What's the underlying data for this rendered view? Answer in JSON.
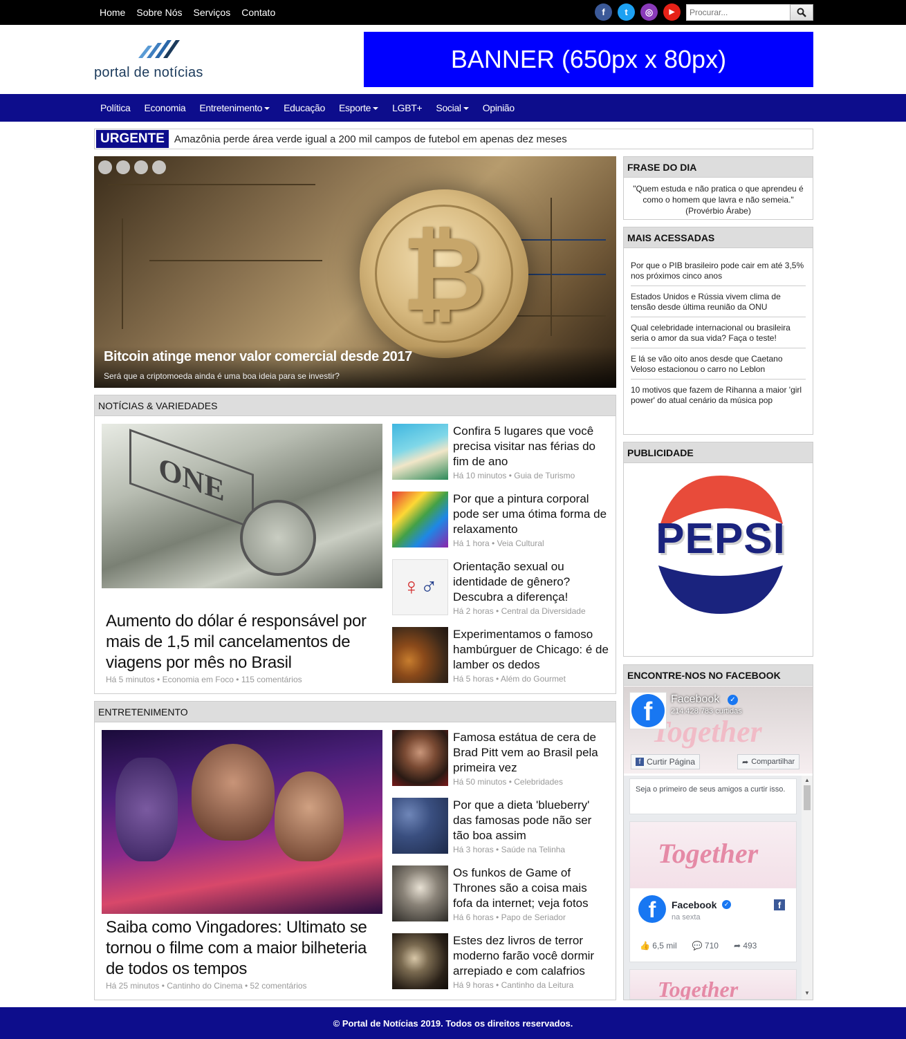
{
  "topnav": [
    "Home",
    "Sobre Nós",
    "Serviços",
    "Contato"
  ],
  "social": [
    {
      "icon": "facebook-icon",
      "glyph": "f",
      "color": "#3b5998"
    },
    {
      "icon": "twitter-icon",
      "glyph": "t",
      "color": "#1da1f2"
    },
    {
      "icon": "instagram-icon",
      "glyph": "◎",
      "color": "#8a3ab9"
    },
    {
      "icon": "youtube-icon",
      "glyph": "▶",
      "color": "#e62117"
    }
  ],
  "search": {
    "placeholder": "Procurar..."
  },
  "logo": {
    "text": "portal de notícias"
  },
  "banner": {
    "text": "BANNER (650px x 80px)"
  },
  "mainnav": [
    {
      "label": "Política",
      "dropdown": false
    },
    {
      "label": "Economia",
      "dropdown": false
    },
    {
      "label": "Entretenimento",
      "dropdown": true
    },
    {
      "label": "Educação",
      "dropdown": false
    },
    {
      "label": "Esporte",
      "dropdown": true
    },
    {
      "label": "LGBT+",
      "dropdown": false
    },
    {
      "label": "Social",
      "dropdown": true
    },
    {
      "label": "Opinião",
      "dropdown": false
    }
  ],
  "urgent": {
    "tag": "URGENTE",
    "text": "Amazônia perde área verde igual a 200 mil campos de futebol em apenas dez meses"
  },
  "hero": {
    "title": "Bitcoin atinge menor valor comercial desde 2017",
    "subtitle": "Será que a criptomoeda ainda é uma boa ideia para se investir?"
  },
  "noticias": {
    "heading": "NOTÍCIAS & VARIEDADES",
    "featured": {
      "title": "Aumento do dólar é responsável por mais de 1,5 mil cancelamentos de viagens por mês no Brasil",
      "meta": "Há 5 minutos • Economia em Foco • 115 comentários"
    },
    "items": [
      {
        "title": "Confira 5 lugares que você precisa visitar nas férias do fim de ano",
        "meta": "Há 10 minutos • Guia de Turismo"
      },
      {
        "title": "Por que a pintura corporal pode ser uma ótima forma de relaxamento",
        "meta": "Há 1 hora • Veia Cultural"
      },
      {
        "title": "Orientação sexual ou identidade de gênero? Descubra a diferença!",
        "meta": "Há 2 horas • Central da Diversidade"
      },
      {
        "title": "Experimentamos o famoso hambúrguer de Chicago: é de lamber os dedos",
        "meta": "Há 5 horas • Além do Gourmet"
      }
    ]
  },
  "entretenimento": {
    "heading": "ENTRETENIMENTO",
    "featured": {
      "title": "Saiba como Vingadores: Ultimato se tornou o filme com a maior bilheteria de todos os tempos",
      "meta": "Há 25 minutos • Cantinho do Cinema • 52 comentários"
    },
    "items": [
      {
        "title": "Famosa estátua de cera de Brad Pitt vem ao Brasil pela primeira vez",
        "meta": "Há 50 minutos • Celebridades"
      },
      {
        "title": "Por que a dieta 'blueberry' das famosas pode não ser tão boa assim",
        "meta": "Há 3 horas • Saúde na Telinha"
      },
      {
        "title": "Os funkos de Game of Thrones são a coisa mais fofa da internet; veja fotos",
        "meta": "Há 6 horas • Papo de Seriador"
      },
      {
        "title": "Estes dez livros de terror moderno farão você dormir arrepiado e com calafrios",
        "meta": "Há 9 horas • Cantinho da Leitura"
      }
    ]
  },
  "frase": {
    "heading": "FRASE DO DIA",
    "text": "\"Quem estuda e não pratica o que aprendeu é como o homem que lavra e não semeia.\"",
    "author": "(Provérbio Árabe)"
  },
  "mais": {
    "heading": "MAIS ACESSADAS",
    "items": [
      "Por que o PIB brasileiro pode cair em até 3,5% nos próximos cinco anos",
      "Estados Unidos e Rússia vivem clima de tensão desde última reunião da ONU",
      "Qual celebridade internacional ou brasileira seria o amor da sua vida? Faça o teste!",
      "E lá se vão oito anos desde que Caetano Veloso estacionou o carro no Leblon",
      "10 motivos que fazem de Rihanna a maior 'girl power' do atual cenário da música pop"
    ]
  },
  "publicidade": {
    "heading": "PUBLICIDADE",
    "brand": "PEPSI"
  },
  "facebook": {
    "heading": "ENCONTRE-NOS NO FACEBOOK",
    "page_name": "Facebook",
    "likes": "214.428.783 curtidas",
    "like_btn": "Curtir Página",
    "share_btn": "Compartilhar",
    "friends_text": "Seja o primeiro de seus amigos a curtir isso.",
    "cover_text": "Together",
    "post": {
      "name": "Facebook",
      "time": "na sexta",
      "likes": "6,5 mil",
      "comments": "710",
      "shares": "493"
    }
  },
  "footer": {
    "text": "© Portal de Notícias 2019. Todos os direitos reservados."
  }
}
